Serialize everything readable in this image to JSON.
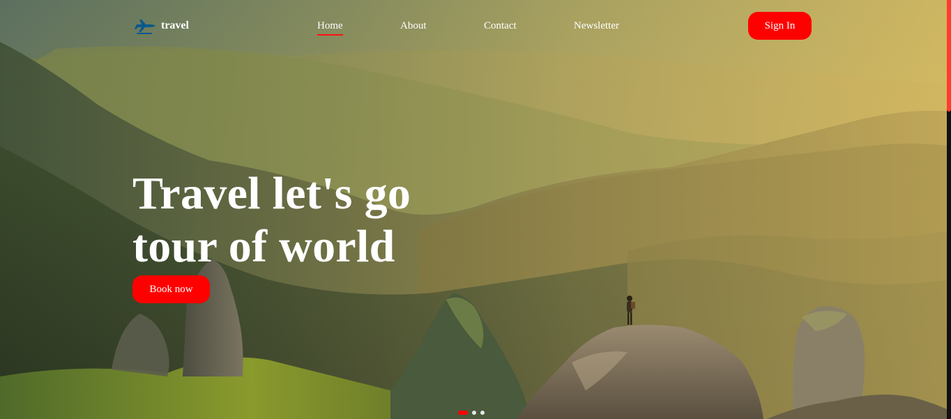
{
  "brand": {
    "name": "travel",
    "icon": "airplane-icon",
    "icon_color": "#0a5a8c"
  },
  "nav": {
    "items": [
      {
        "label": "Home",
        "active": true
      },
      {
        "label": "About",
        "active": false
      },
      {
        "label": "Contact",
        "active": false
      },
      {
        "label": "Newsletter",
        "active": false
      }
    ],
    "signin_label": "Sign In"
  },
  "hero": {
    "title_line1": "Travel let's go",
    "title_line2": "tour of world",
    "cta_label": "Book now"
  },
  "carousel": {
    "slide_count": 3,
    "active_index": 0
  },
  "colors": {
    "accent": "#ff0000",
    "text": "#ffffff",
    "scrollbar_thumb": "#ff3b30"
  }
}
